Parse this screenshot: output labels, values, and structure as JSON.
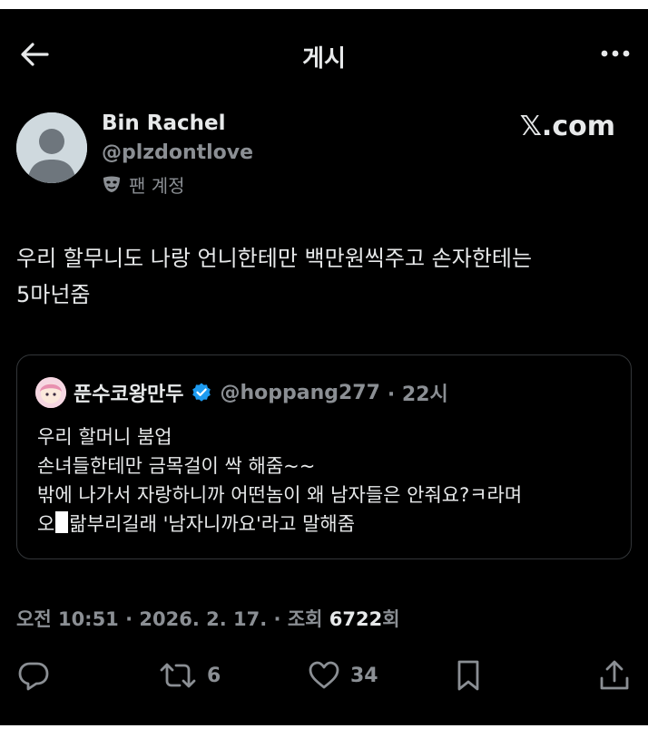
{
  "header": {
    "title": "게시"
  },
  "author": {
    "name": "Bin Rachel",
    "handle": "@plzdontlove",
    "fan_label": "팬 계정"
  },
  "source": {
    "logo_text": "𝕏.com"
  },
  "tweet": {
    "text": "우리 할무니도 나랑 언니한테만 백만원씩주고 손자한테는\n5마넌줌"
  },
  "quote": {
    "name": "푼수코왕만두",
    "handle": "@hoppang277",
    "time": "· 22시",
    "lines": [
      "우리 할머니 붐업",
      "손녀들한테만 금목걸이 싹 해줌~~",
      "밖에 나가서 자랑하니까 어떤놈이 왜 남자들은 안줘요?ㅋ라며"
    ],
    "last_line_start": "오",
    "last_line_end": "랆부리길래 '남자니까요'라고 말해줌"
  },
  "meta": {
    "time": "오전 10:51 · 2026. 2. 17. · 조회",
    "views": "6722",
    "views_unit": "회"
  },
  "actions": {
    "reply_count": "",
    "retweet_count": "6",
    "like_count": "34"
  },
  "colors": {
    "background": "#000000",
    "text": "#e7e9ea",
    "secondary": "#8b8f94",
    "verified": "#1d9bf0",
    "border": "#333639"
  }
}
